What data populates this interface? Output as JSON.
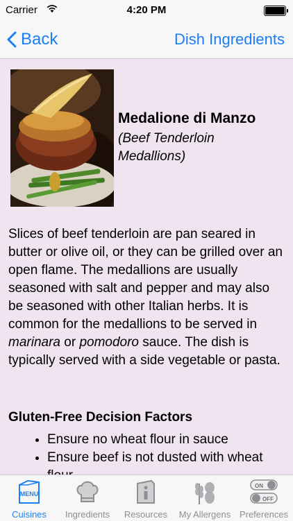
{
  "status_bar": {
    "carrier": "Carrier",
    "time": "4:20 PM"
  },
  "nav_bar": {
    "back_label": "Back",
    "right_label": "Dish Ingredients"
  },
  "dish": {
    "name": "Medalione di Manzo",
    "english_name": "(Beef Tenderloin Medallions)",
    "description_part1": "Slices of beef tenderloin are pan seared in butter or olive oil, or they can be grilled over an open flame. The medallions are usually seasoned with salt and pepper and may also be seasoned with other Italian herbs. It is common for the medallions to be served in ",
    "description_sauce1": "marinara",
    "description_or": " or ",
    "description_sauce2": "pomodoro",
    "description_part2": " sauce. The dish is typically served with a side vegetable or pasta."
  },
  "factors": {
    "title": "Gluten-Free Decision Factors",
    "items": [
      "Ensure no wheat flour in sauce",
      "Ensure beef is not dusted with wheat flour"
    ]
  },
  "tab_bar": {
    "tabs": [
      {
        "label": "Cuisines",
        "icon": "menu-icon",
        "active": true
      },
      {
        "label": "Ingredients",
        "icon": "chef-hat-icon",
        "active": false
      },
      {
        "label": "Resources",
        "icon": "info-icon",
        "active": false
      },
      {
        "label": "My Allergens",
        "icon": "wheat-peanut-icon",
        "active": false
      },
      {
        "label": "Preferences",
        "icon": "toggle-switches-icon",
        "active": false
      }
    ],
    "menu_icon_text": "MENU",
    "toggle_on_text": "ON",
    "toggle_off_text": "OFF"
  },
  "colors": {
    "accent": "#1a7ef7",
    "background": "#efe4ef",
    "inactive_tab": "#8e8e93"
  }
}
